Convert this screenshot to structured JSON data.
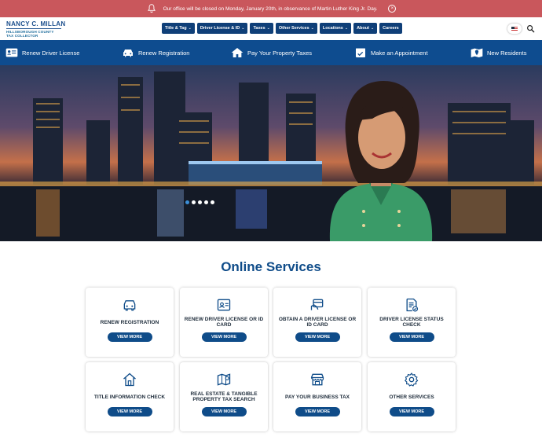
{
  "alert": {
    "message": "Our office will be closed on Monday, January 20th, in observance of Martin Luther King Jr. Day.",
    "close_glyph": "×",
    "icon": "bell-icon"
  },
  "logo": {
    "name": "NANCY C. MILLAN",
    "line1": "HILLSBOROUGH COUNTY",
    "line2": "TAX COLLECTOR"
  },
  "topnav": [
    {
      "label": "Title & Tag",
      "chevron": "⌄"
    },
    {
      "label": "Driver License & ID",
      "chevron": "⌄"
    },
    {
      "label": "Taxes",
      "chevron": "⌄"
    },
    {
      "label": "Other Services",
      "chevron": "⌄"
    },
    {
      "label": "Locations",
      "chevron": "⌄"
    },
    {
      "label": "About",
      "chevron": "⌄"
    },
    {
      "label": "Careers",
      "chevron": ""
    }
  ],
  "actions": [
    {
      "label": "Renew Driver License",
      "icon": "id-card-icon"
    },
    {
      "label": "Renew Registration",
      "icon": "car-icon"
    },
    {
      "label": "Pay Your Property Taxes",
      "icon": "house-icon"
    },
    {
      "label": "Make an Appointment",
      "icon": "calendar-check-icon"
    },
    {
      "label": "New Residents",
      "icon": "map-pin-icon"
    }
  ],
  "hero": {
    "slide_count": 5,
    "active_slide": 1
  },
  "services": {
    "title": "Online Services",
    "button_label": "VIEW MORE",
    "cards": [
      {
        "label": "RENEW REGISTRATION",
        "icon": "car-icon"
      },
      {
        "label": "RENEW DRIVER LICENSE OR ID CARD",
        "icon": "id-card-icon"
      },
      {
        "label": "OBTAIN A DRIVER LICENSE OR ID CARD",
        "icon": "card-hand-icon"
      },
      {
        "label": "DRIVER LICENSE STATUS CHECK",
        "icon": "document-check-icon"
      },
      {
        "label": "TITLE INFORMATION CHECK",
        "icon": "house-icon"
      },
      {
        "label": "REAL ESTATE & TANGIBLE PROPERTY TAX SEARCH",
        "icon": "map-icon"
      },
      {
        "label": "PAY YOUR BUSINESS TAX",
        "icon": "storefront-icon"
      },
      {
        "label": "OTHER SERVICES",
        "icon": "gear-icon"
      }
    ]
  },
  "colors": {
    "alert_bg": "#c9575c",
    "brand_blue": "#0e4c8f",
    "nav_blue": "#0f3f78"
  }
}
